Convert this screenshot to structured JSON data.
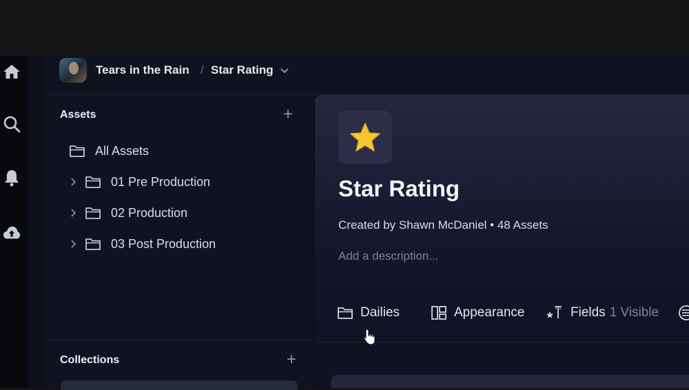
{
  "breadcrumb": {
    "project": "Tears in the Rain",
    "separator": "/",
    "current": "Star Rating"
  },
  "sidebar": {
    "assets_title": "Assets",
    "tree": [
      {
        "label": "All Assets",
        "expandable": false
      },
      {
        "label": "01 Pre Production",
        "expandable": true
      },
      {
        "label": "02 Production",
        "expandable": true
      },
      {
        "label": "03 Post Production",
        "expandable": true
      }
    ],
    "collections_title": "Collections"
  },
  "collection": {
    "icon": "star-emoji",
    "title": "Star Rating",
    "meta": "Created by Shawn McDaniel • 48 Assets",
    "description_placeholder": "Add a description..."
  },
  "toolbar": {
    "dailies": "Dailies",
    "appearance": "Appearance",
    "fields": "Fields",
    "fields_count": "1 Visible"
  },
  "colors": {
    "background": "#0c0f1a",
    "sidebar": "#0f1321",
    "star": "#f7c531",
    "text": "#e6e7ee",
    "muted": "#7d8192"
  }
}
